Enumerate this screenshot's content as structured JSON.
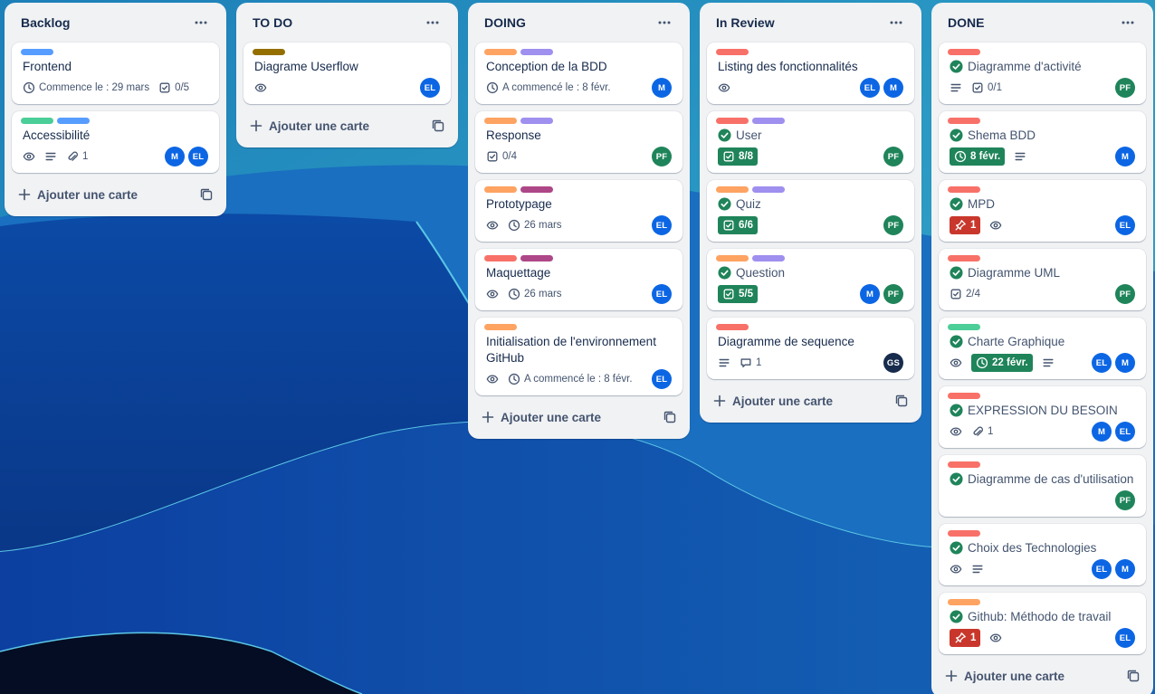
{
  "colors": {
    "label_blue": "#579dff",
    "label_green": "#4bce97",
    "label_orange": "#fea362",
    "label_purple": "#9f8fef",
    "label_red": "#f87168",
    "label_magenta": "#ae4787",
    "label_olive": "#946f00",
    "avatar_EL": "#0c66e4",
    "avatar_M": "#0c66e4",
    "avatar_PF": "#1f845a",
    "avatar_GS": "#172b4d",
    "check_green": "#1f845a"
  },
  "add_card_label": "Ajouter une carte",
  "lists": [
    {
      "title": "Backlog",
      "cards": [
        {
          "labels": [
            "label_blue"
          ],
          "title": "Frontend",
          "done": false,
          "badges": [
            {
              "icon": "clock-icon",
              "text": "Commence le : 29 mars"
            },
            {
              "icon": "checklist-icon",
              "text": "0/5"
            }
          ],
          "members": []
        },
        {
          "labels": [
            "label_green",
            "label_blue"
          ],
          "title": "Accessibilité",
          "done": false,
          "badges": [
            {
              "icon": "eye-icon"
            },
            {
              "icon": "description-icon"
            },
            {
              "icon": "attachment-icon",
              "text": "1"
            }
          ],
          "members": [
            "M",
            "EL"
          ]
        }
      ]
    },
    {
      "title": "TO DO",
      "cards": [
        {
          "labels": [
            "label_olive"
          ],
          "title": "Diagrame Userflow",
          "done": false,
          "badges": [
            {
              "icon": "eye-icon"
            }
          ],
          "members": [
            "EL"
          ]
        }
      ]
    },
    {
      "title": "DOING",
      "cards": [
        {
          "labels": [
            "label_orange",
            "label_purple"
          ],
          "title": "Conception de la BDD",
          "done": false,
          "badges": [
            {
              "icon": "clock-icon",
              "text": "A commencé le : 8 févr."
            }
          ],
          "members": [
            "M"
          ]
        },
        {
          "labels": [
            "label_orange",
            "label_purple"
          ],
          "title": "Response",
          "done": false,
          "badges": [
            {
              "icon": "checklist-icon",
              "text": "0/4"
            }
          ],
          "members": [
            "PF"
          ]
        },
        {
          "labels": [
            "label_orange",
            "label_magenta"
          ],
          "title": "Prototypage",
          "done": false,
          "badges": [
            {
              "icon": "eye-icon"
            },
            {
              "icon": "clock-icon",
              "text": "26 mars"
            }
          ],
          "members": [
            "EL"
          ]
        },
        {
          "labels": [
            "label_red",
            "label_magenta"
          ],
          "title": "Maquettage",
          "done": false,
          "badges": [
            {
              "icon": "eye-icon"
            },
            {
              "icon": "clock-icon",
              "text": "26 mars"
            }
          ],
          "members": [
            "EL"
          ]
        },
        {
          "labels": [
            "label_orange"
          ],
          "title": "Initialisation de l'environnement GitHub",
          "done": false,
          "badges": [
            {
              "icon": "eye-icon"
            },
            {
              "icon": "clock-icon",
              "text": "A commencé le : 8 févr."
            }
          ],
          "members": [
            "EL"
          ]
        }
      ]
    },
    {
      "title": "In Review",
      "cards": [
        {
          "labels": [
            "label_red"
          ],
          "title": "Listing des fonctionnalités",
          "done": false,
          "badges": [
            {
              "icon": "eye-icon"
            }
          ],
          "members": [
            "EL",
            "M"
          ]
        },
        {
          "labels": [
            "label_red",
            "label_purple"
          ],
          "title": "User",
          "done": true,
          "badges": [
            {
              "icon": "checklist-icon",
              "text": "8/8",
              "style": "green"
            }
          ],
          "members": [
            "PF"
          ]
        },
        {
          "labels": [
            "label_orange",
            "label_purple"
          ],
          "title": "Quiz",
          "done": true,
          "badges": [
            {
              "icon": "checklist-icon",
              "text": "6/6",
              "style": "green"
            }
          ],
          "members": [
            "PF"
          ]
        },
        {
          "labels": [
            "label_orange",
            "label_purple"
          ],
          "title": "Question",
          "done": true,
          "badges": [
            {
              "icon": "checklist-icon",
              "text": "5/5",
              "style": "green"
            }
          ],
          "members": [
            "M",
            "PF"
          ]
        },
        {
          "labels": [
            "label_red"
          ],
          "title": "Diagramme de sequence",
          "done": false,
          "badges": [
            {
              "icon": "description-icon"
            },
            {
              "icon": "comment-icon",
              "text": "1"
            }
          ],
          "members": [
            "GS"
          ]
        }
      ]
    },
    {
      "title": "DONE",
      "cards": [
        {
          "labels": [
            "label_red"
          ],
          "title": "Diagramme d'activité",
          "done": true,
          "badges": [
            {
              "icon": "description-icon"
            },
            {
              "icon": "checklist-icon",
              "text": "0/1"
            }
          ],
          "members": [
            "PF"
          ]
        },
        {
          "labels": [
            "label_red"
          ],
          "title": "Shema BDD",
          "done": true,
          "badges": [
            {
              "icon": "clock-icon",
              "text": "8 févr.",
              "style": "green"
            },
            {
              "icon": "description-icon"
            }
          ],
          "members": [
            "M"
          ]
        },
        {
          "labels": [
            "label_red"
          ],
          "title": "MPD",
          "done": true,
          "badges": [
            {
              "icon": "pin-icon",
              "text": "1",
              "style": "red"
            },
            {
              "icon": "eye-icon"
            }
          ],
          "members": [
            "EL"
          ]
        },
        {
          "labels": [
            "label_red"
          ],
          "title": "Diagramme UML",
          "done": true,
          "badges": [
            {
              "icon": "checklist-icon",
              "text": "2/4"
            }
          ],
          "members": [
            "PF"
          ]
        },
        {
          "labels": [
            "label_green"
          ],
          "title": "Charte Graphique",
          "done": true,
          "badges": [
            {
              "icon": "eye-icon"
            },
            {
              "icon": "clock-icon",
              "text": "22 févr.",
              "style": "green"
            },
            {
              "icon": "description-icon"
            }
          ],
          "members": [
            "EL",
            "M"
          ]
        },
        {
          "labels": [
            "label_red"
          ],
          "title": "EXPRESSION DU BESOIN",
          "done": true,
          "badges": [
            {
              "icon": "eye-icon"
            },
            {
              "icon": "attachment-icon",
              "text": "1"
            }
          ],
          "members": [
            "M",
            "EL"
          ]
        },
        {
          "labels": [
            "label_red"
          ],
          "title": "Diagramme de cas d'utilisation",
          "done": true,
          "badges": [],
          "members": [
            "PF"
          ]
        },
        {
          "labels": [
            "label_red"
          ],
          "title": "Choix des Technologies",
          "done": true,
          "badges": [
            {
              "icon": "eye-icon"
            },
            {
              "icon": "description-icon"
            }
          ],
          "members": [
            "EL",
            "M"
          ]
        },
        {
          "labels": [
            "label_orange"
          ],
          "title": "Github: Méthodo de travail",
          "done": true,
          "badges": [
            {
              "icon": "pin-icon",
              "text": "1",
              "style": "red"
            },
            {
              "icon": "eye-icon"
            }
          ],
          "members": [
            "EL"
          ]
        }
      ]
    }
  ]
}
